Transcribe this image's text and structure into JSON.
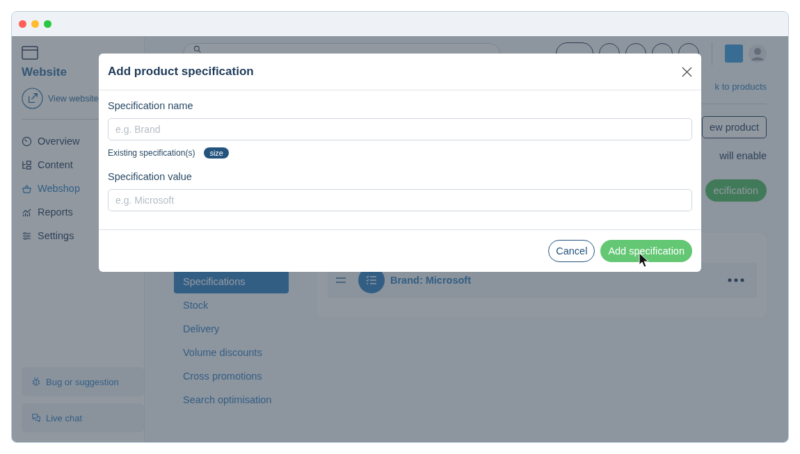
{
  "sidebar": {
    "title": "Website",
    "view_link": "View website",
    "items": [
      {
        "label": "Overview",
        "selected": false
      },
      {
        "label": "Content",
        "selected": false
      },
      {
        "label": "Webshop",
        "selected": true
      },
      {
        "label": "Reports",
        "selected": false
      },
      {
        "label": "Settings",
        "selected": false
      }
    ],
    "footer": [
      "Bug or suggestion",
      "Live chat"
    ]
  },
  "page": {
    "back_link": "k to products",
    "new_product_button": "ew product",
    "note": "will enable",
    "add_button": "ecification",
    "tabs": [
      {
        "label": "Specifications",
        "selected": true
      },
      {
        "label": "Stock",
        "selected": false
      },
      {
        "label": "Delivery",
        "selected": false
      },
      {
        "label": "Volume discounts",
        "selected": false
      },
      {
        "label": "Cross promotions",
        "selected": false
      },
      {
        "label": "Search optimisation",
        "selected": false
      }
    ],
    "specifications": [
      "Brand: Microsoft"
    ]
  },
  "modal": {
    "title": "Add product specification",
    "fields": [
      {
        "label": "Specification name",
        "placeholder": "e.g. Brand"
      },
      {
        "label": "Specification value",
        "placeholder": "e.g. Microsoft"
      }
    ],
    "existing": {
      "label": "Existing specification(s)",
      "tags": [
        "size"
      ]
    },
    "cancel_button": "Cancel",
    "confirm_button": "Add specification"
  }
}
